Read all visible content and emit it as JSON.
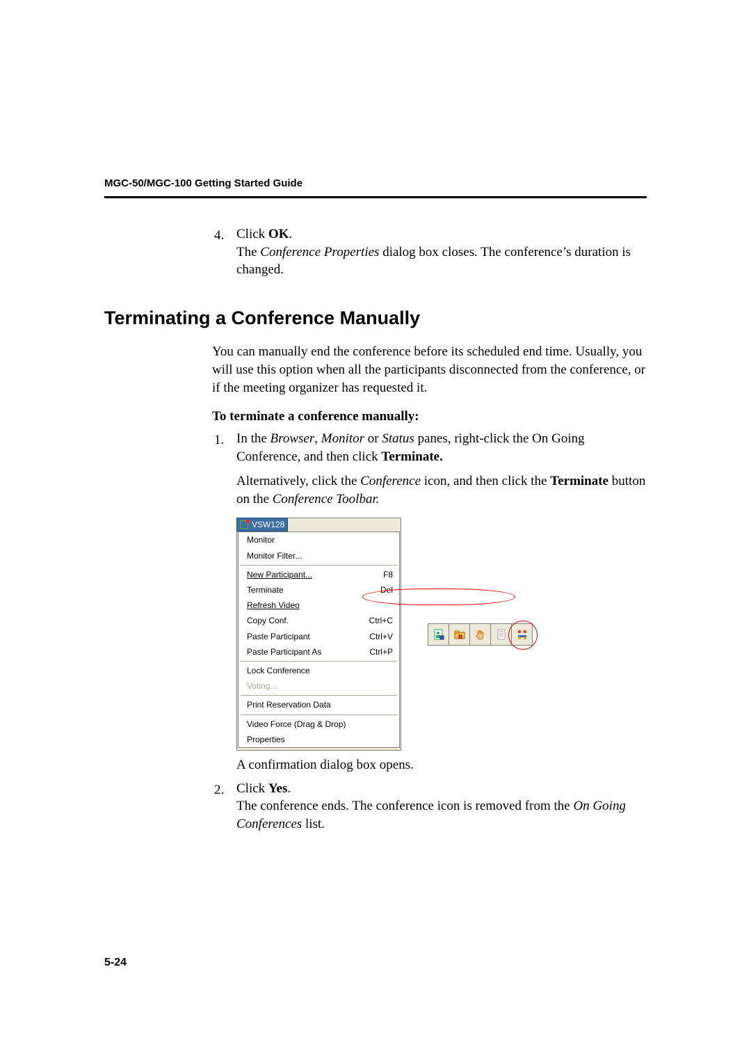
{
  "header": {
    "title": "MGC-50/MGC-100 Getting Started Guide"
  },
  "body": {
    "step4": {
      "num": "4.",
      "line1a": "Click ",
      "ok": "OK",
      "line1b": ".",
      "line2a": "The ",
      "cpdlg": "Conference Properties",
      "line2b": " dialog box closes. The conference’s duration is changed."
    },
    "heading": "Terminating a Conference Manually",
    "intro": "You can manually end the conference before its scheduled end time. Usually, you will use this option when all the participants disconnected from the conference, or if the meeting organizer has requested it.",
    "subhead": "To terminate a conference manually:",
    "step1": {
      "num": "1.",
      "a": "In the ",
      "browser": "Browser",
      "b": ", ",
      "monitor": "Monitor",
      "c": " or ",
      "status": "Status",
      "d": " panes, right-click the On Going Conference, and then click ",
      "terminate": "Terminate.",
      "e": "Alternatively, click the ",
      "conf": "Conference",
      "f": " icon, and then click the ",
      "termbtn": "Terminate",
      "g": " button on the ",
      "tb": "Conference Toolbar."
    },
    "confirm": "A confirmation dialog box opens.",
    "step2": {
      "num": "2.",
      "a": "Click ",
      "yes": "Yes",
      "b": ".",
      "c": "The conference ends. The conference icon is removed from the ",
      "ogc": "On Going Conferences",
      "d": " list."
    }
  },
  "menu": {
    "conf_label": "VSW128",
    "items": [
      {
        "label": "Monitor"
      },
      {
        "label": "Monitor Filter..."
      },
      {
        "label": "New Participant...",
        "accel": "F8"
      },
      {
        "label": "Terminate",
        "accel": "Del"
      },
      {
        "label": "Refresh Video"
      },
      {
        "label": "Copy Conf.",
        "accel": "Ctrl+C"
      },
      {
        "label": "Paste Participant",
        "accel": "Ctrl+V"
      },
      {
        "label": "Paste Participant As",
        "accel": "Ctrl+P"
      },
      {
        "label": "Lock Conference"
      },
      {
        "label": "Voting..."
      },
      {
        "label": "Print Reservation Data"
      },
      {
        "label": "Video Force (Drag & Drop)"
      },
      {
        "label": "Properties"
      }
    ]
  },
  "footer": {
    "page": "5-24"
  }
}
